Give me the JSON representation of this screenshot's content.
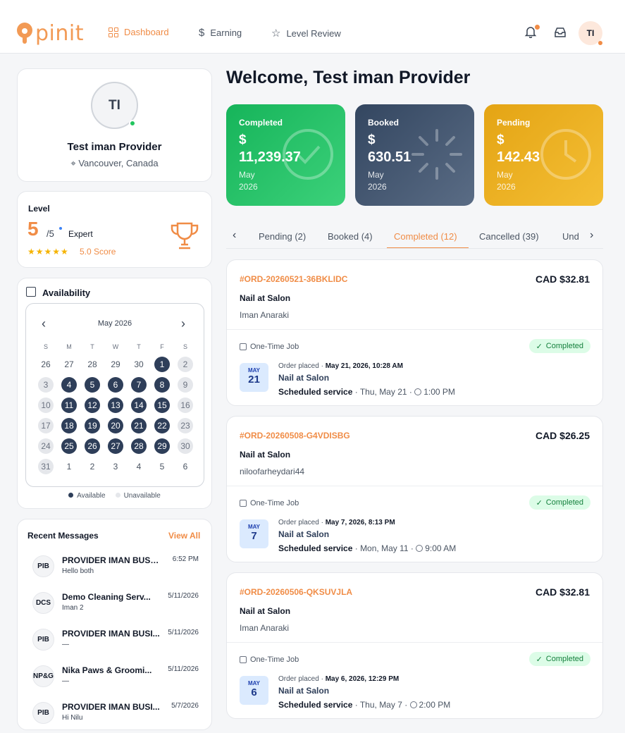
{
  "brand": {
    "name": "pinit",
    "color": "#f08c46"
  },
  "nav": [
    {
      "label": "Dashboard",
      "icon": "grid-icon",
      "active": true
    },
    {
      "label": "Earning",
      "icon": "dollar-icon",
      "active": false
    },
    {
      "label": "Level Review",
      "icon": "star-icon",
      "active": false
    }
  ],
  "user_initials": "TI",
  "profile": {
    "initials": "TI",
    "name": "Test iman Provider",
    "location": "Vancouver, Canada"
  },
  "level": {
    "title": "Level",
    "value": "5",
    "of": "/5",
    "name": "Expert",
    "stars": "★★★★★",
    "rating": 5,
    "score": "5.0 Score"
  },
  "availability": {
    "title": "Availability",
    "month": "May 2026",
    "dow": [
      "S",
      "M",
      "T",
      "W",
      "T",
      "F",
      "S"
    ],
    "weeks": [
      [
        [
          "26",
          "o"
        ],
        [
          "27",
          "o"
        ],
        [
          "28",
          "o"
        ],
        [
          "29",
          "o"
        ],
        [
          "30",
          "o"
        ],
        [
          "1",
          "a"
        ],
        [
          "2",
          "u"
        ]
      ],
      [
        [
          "3",
          "u"
        ],
        [
          "4",
          "a"
        ],
        [
          "5",
          "a"
        ],
        [
          "6",
          "a"
        ],
        [
          "7",
          "a"
        ],
        [
          "8",
          "a"
        ],
        [
          "9",
          "u"
        ]
      ],
      [
        [
          "10",
          "u"
        ],
        [
          "11",
          "a"
        ],
        [
          "12",
          "a"
        ],
        [
          "13",
          "a"
        ],
        [
          "14",
          "a"
        ],
        [
          "15",
          "a"
        ],
        [
          "16",
          "u"
        ]
      ],
      [
        [
          "17",
          "u"
        ],
        [
          "18",
          "a"
        ],
        [
          "19",
          "a"
        ],
        [
          "20",
          "a"
        ],
        [
          "21",
          "a"
        ],
        [
          "22",
          "a"
        ],
        [
          "23",
          "u"
        ]
      ],
      [
        [
          "24",
          "u"
        ],
        [
          "25",
          "a"
        ],
        [
          "26",
          "a"
        ],
        [
          "27",
          "a"
        ],
        [
          "28",
          "a"
        ],
        [
          "29",
          "a"
        ],
        [
          "30",
          "u"
        ]
      ],
      [
        [
          "31",
          "u"
        ],
        [
          "1",
          "o"
        ],
        [
          "2",
          "o"
        ],
        [
          "3",
          "o"
        ],
        [
          "4",
          "o"
        ],
        [
          "5",
          "o"
        ],
        [
          "6",
          "o"
        ]
      ]
    ],
    "legend_available": "Available",
    "legend_unavailable": "Unavailable",
    "colors": {
      "available": "#2e3e59",
      "unavailable": "#e5e7eb"
    }
  },
  "messages": {
    "title": "Recent Messages",
    "view_all": "View All",
    "items": [
      {
        "initials": "PIB",
        "name": "PROVIDER IMAN BUSIN...",
        "preview": "Hello both",
        "time": "6:52 PM"
      },
      {
        "initials": "DCS",
        "name": "Demo Cleaning Serv...",
        "preview": "Iman 2",
        "time": "5/11/2026"
      },
      {
        "initials": "PIB",
        "name": "PROVIDER IMAN BUSI...",
        "preview": "—",
        "time": "5/11/2026"
      },
      {
        "initials": "NP&G",
        "name": "Nika Paws & Groomi...",
        "preview": "—",
        "time": "5/11/2026"
      },
      {
        "initials": "PIB",
        "name": "PROVIDER IMAN BUSI...",
        "preview": "Hi Nilu",
        "time": "5/7/2026"
      }
    ]
  },
  "welcome": "Welcome, Test iman Provider",
  "stats": [
    {
      "label": "Completed",
      "currency": "$",
      "amount": "11,239.37",
      "month": "May",
      "year": "2026",
      "icon": "check-circle-icon"
    },
    {
      "label": "Booked",
      "currency": "$",
      "amount": "630.51",
      "month": "May",
      "year": "2026",
      "icon": "loader-icon"
    },
    {
      "label": "Pending",
      "currency": "$",
      "amount": "142.43",
      "month": "May",
      "year": "2026",
      "icon": "clock-icon"
    }
  ],
  "tabs": [
    "Pending (2)",
    "Booked (4)",
    "Completed (12)",
    "Cancelled (39)",
    "Und"
  ],
  "active_tab": "Completed (12)",
  "orders": [
    {
      "id": "#ORD-20260521-36BKLIDC",
      "price": "CAD $32.81",
      "service": "Nail at Salon",
      "customer": "Iman Anaraki",
      "type": "One-Time Job",
      "status": "Completed",
      "date_mon": "MAY",
      "date_day": "21",
      "placed_label": "Order placed · ",
      "placed_at": "May 21, 2026, 10:28 AM",
      "sched_label": "Scheduled service",
      "sched_date": "Thu, May 21",
      "sched_time": "1:00 PM"
    },
    {
      "id": "#ORD-20260508-G4VDISBG",
      "price": "CAD $26.25",
      "service": "Nail at Salon",
      "customer": "niloofarheydari44",
      "type": "One-Time Job",
      "status": "Completed",
      "date_mon": "MAY",
      "date_day": "7",
      "placed_label": "Order placed · ",
      "placed_at": "May 7, 2026, 8:13 PM",
      "sched_label": "Scheduled service",
      "sched_date": "Mon, May 11",
      "sched_time": "9:00 AM"
    },
    {
      "id": "#ORD-20260506-QKSUVJLA",
      "price": "CAD $32.81",
      "service": "Nail at Salon",
      "customer": "Iman Anaraki",
      "type": "One-Time Job",
      "status": "Completed",
      "date_mon": "MAY",
      "date_day": "6",
      "placed_label": "Order placed · ",
      "placed_at": "May 6, 2026, 12:29 PM",
      "sched_label": "Scheduled service",
      "sched_date": "Thu, May 7",
      "sched_time": "2:00 PM"
    }
  ]
}
